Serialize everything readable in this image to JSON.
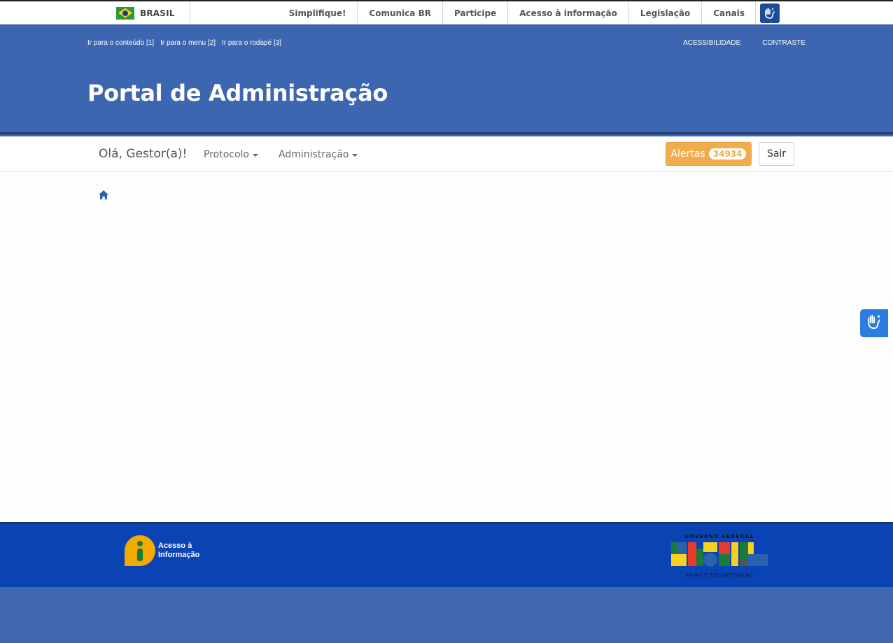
{
  "govbar": {
    "country_label": "BRASIL",
    "links": [
      "Simplifique!",
      "Comunica BR",
      "Participe",
      "Acesso à informação",
      "Legislação",
      "Canais"
    ]
  },
  "header": {
    "skip_links": [
      "Ir para o conteúdo [1]",
      "Ir para o menu [2]",
      "Ir para o rodapé [3]"
    ],
    "accessibility_label": "ACESSIBILIDADE",
    "contrast_label": "CONTRASTE",
    "title": "Portal de Administração"
  },
  "navbar": {
    "greeting": "Olá, Gestor(a)!",
    "menus": [
      "Protocolo",
      "Administração"
    ],
    "alerts_label": "Alertas",
    "alerts_count": "34934",
    "logout_label": "Sair"
  },
  "footer": {
    "lai_text": "Acesso à Informação",
    "gov_logo_top": "GOVERNO FEDERAL",
    "gov_logo_main": "BRASIL",
    "gov_logo_bottom": "UNIÃO E RECONSTRUÇÃO"
  },
  "colors": {
    "header_blue": "#3d66b1",
    "footer_blue": "#0a43b3",
    "alert_orange": "#f0ad4e",
    "vlibras_blue": "#2b7de0"
  },
  "icons": [
    "brazil-flag-icon",
    "vlibras-hands-icon",
    "home-icon",
    "acesso-informacao-icon"
  ]
}
